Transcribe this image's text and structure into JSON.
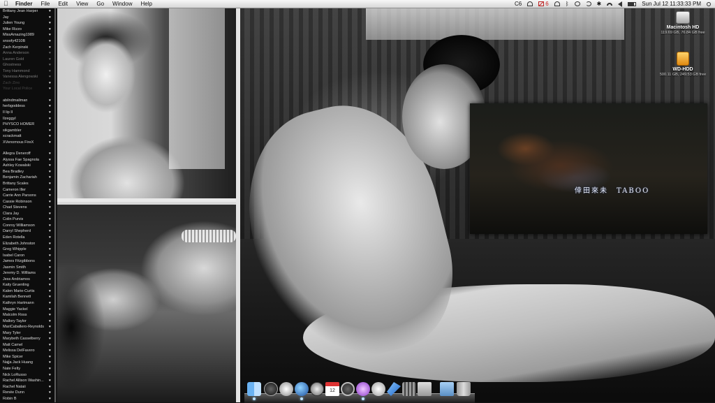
{
  "menubar": {
    "app_name": "Finder",
    "menus": [
      "File",
      "Edit",
      "View",
      "Go",
      "Window",
      "Help"
    ],
    "status_text": "C6",
    "gmail_count": "6",
    "clock": "Sun Jul 12  11:33:33 PM"
  },
  "names_list": {
    "group1": [
      "Brittany Jean Harper",
      "Jay",
      "Julien Young",
      "Mike Rizzo",
      "MissAmazing1989",
      "snoofy4210B",
      "Zach Kerpinski"
    ],
    "group2_dim": [
      "Anna Anderson",
      "Lauren Gold",
      "Ghostness",
      "Tony Hammond",
      "Vanessa Alengowski"
    ],
    "group2_faint": [
      "Zach Zino",
      "Your Local Police"
    ],
    "group3": [
      "abilndmailman",
      "herbgoddess",
      "Il lip Il",
      "Ilzeggyl",
      "PHYSCO HOMER",
      "sikgambler",
      "xcrackmatt",
      "XVenomous FireX"
    ],
    "group4": [
      "Allegra Deneroff",
      "Alyssa Fae Spagnola",
      "Ashley Kowalski",
      "Bea Bradley",
      "Benjamin Zachariah",
      "Brittany Scales",
      "Cameron Iller",
      "Carrie Ann Parsons",
      "Cassie Robinson",
      "Chad Stevens",
      "Clara Jay",
      "Colin Purvis",
      "Conroy Williamson",
      "Darryl Shepherd",
      "Eden Rotella",
      "Elizabeth Johnston",
      "Greg Whipple",
      "Isabel Caron",
      "James Fitzgibbons",
      "Jasmin Smith",
      "Jeremy D. Williams",
      "Jess Andriamos",
      "Kaity Gruenling",
      "Kalen Marie-Curtis",
      "Kamilah Bennett",
      "Kathryn Hartmann",
      "Maggie Yackel",
      "Malcolm Ross",
      "Mallory Taylor",
      "MariCaballero-Reynolds",
      "Mary Tyler",
      "Marybeth Casselberry",
      "Matt Camel",
      "Melissa DelFavero",
      "Mike Spicer",
      "Najja Jack Huang",
      "Nate Felty",
      "Nick LoRusso",
      "Rachel Allison Washin...",
      "Rachel Nataii",
      "Renée Dunn",
      "Robin B",
      "Rodney Mason Jr.",
      "Silvina Guerrero"
    ]
  },
  "video": {
    "caption": "倖田來未　TABOO"
  },
  "desktop_icons": [
    {
      "label": "Macintosh HD",
      "sub": "119.69 GB, 76.84 GB free",
      "icon": "hard-drive-icon"
    },
    {
      "label": "WD-HDD",
      "sub": "500.11 GB, 249.53 GB free",
      "icon": "usb-drive-icon"
    }
  ],
  "dock": {
    "apps": [
      "finder",
      "dashboard",
      "robot",
      "globe",
      "compass",
      "calendar",
      "camera",
      "itunes",
      "speaker",
      "feather",
      "system-prefs",
      "zip",
      "folder",
      "trash"
    ],
    "calendar_date": "12"
  }
}
